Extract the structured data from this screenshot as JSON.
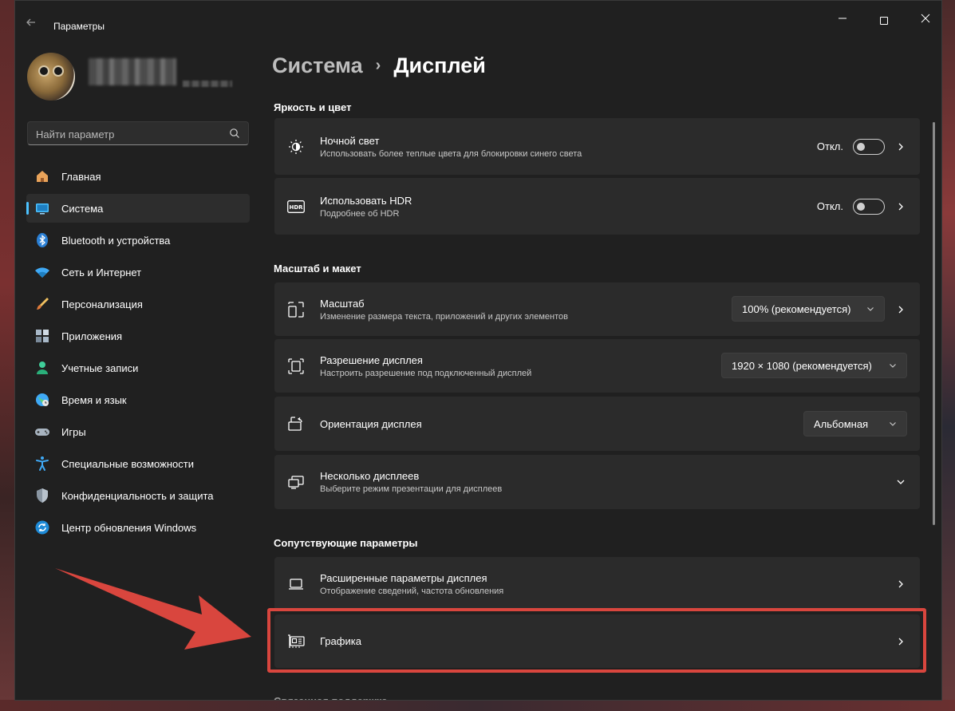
{
  "window": {
    "title": "Параметры",
    "back_icon": "back-arrow-icon"
  },
  "sidebar": {
    "search_placeholder": "Найти параметр",
    "items": [
      {
        "label": "Главная",
        "icon": "home-icon",
        "active": false
      },
      {
        "label": "Система",
        "icon": "system-icon",
        "active": true
      },
      {
        "label": "Bluetooth и устройства",
        "icon": "bluetooth-icon",
        "active": false
      },
      {
        "label": "Сеть и Интернет",
        "icon": "wifi-icon",
        "active": false
      },
      {
        "label": "Персонализация",
        "icon": "brush-icon",
        "active": false
      },
      {
        "label": "Приложения",
        "icon": "apps-icon",
        "active": false
      },
      {
        "label": "Учетные записи",
        "icon": "account-icon",
        "active": false
      },
      {
        "label": "Время и язык",
        "icon": "globe-icon",
        "active": false
      },
      {
        "label": "Игры",
        "icon": "gamepad-icon",
        "active": false
      },
      {
        "label": "Специальные возможности",
        "icon": "accessibility-icon",
        "active": false
      },
      {
        "label": "Конфиденциальность и защита",
        "icon": "shield-icon",
        "active": false
      },
      {
        "label": "Центр обновления Windows",
        "icon": "update-icon",
        "active": false
      }
    ]
  },
  "breadcrumb": {
    "parent": "Система",
    "separator": "›",
    "current": "Дисплей"
  },
  "sections": {
    "brightness": {
      "title": "Яркость и цвет",
      "night_light": {
        "title": "Ночной свет",
        "subtitle": "Использовать более теплые цвета для блокировки синего света",
        "state": "Откл."
      },
      "hdr": {
        "title": "Использовать HDR",
        "subtitle": "Подробнее об HDR",
        "state": "Откл."
      }
    },
    "scale_layout": {
      "title": "Масштаб и макет",
      "scale": {
        "title": "Масштаб",
        "subtitle": "Изменение размера текста, приложений и других элементов",
        "value": "100% (рекомендуется)"
      },
      "resolution": {
        "title": "Разрешение дисплея",
        "subtitle": "Настроить разрешение под подключенный дисплей",
        "value": "1920 × 1080 (рекомендуется)"
      },
      "orientation": {
        "title": "Ориентация дисплея",
        "value": "Альбомная"
      },
      "multiple": {
        "title": "Несколько дисплеев",
        "subtitle": "Выберите режим презентации для дисплеев"
      }
    },
    "related": {
      "title": "Сопутствующие параметры",
      "advanced": {
        "title": "Расширенные параметры дисплея",
        "subtitle": "Отображение сведений, частота обновления"
      },
      "graphics": {
        "title": "Графика"
      }
    },
    "next_section_cut": "Связанная поддержка"
  },
  "colors": {
    "accent": "#4cc2ff",
    "highlight": "#d9463e",
    "window_bg": "#202020",
    "card_bg": "#2b2b2b"
  }
}
